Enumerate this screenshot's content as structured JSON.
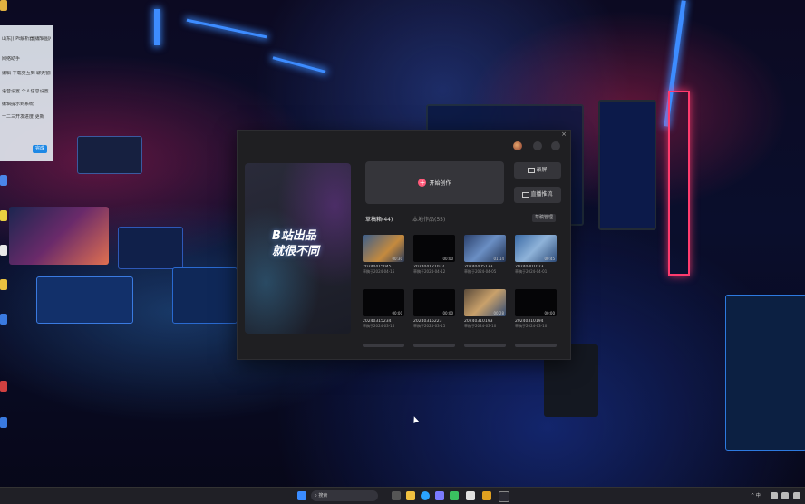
{
  "widget": {
    "rows": [
      "山东|( Pt解析器|编辑图片 第1步",
      "网络助手",
      "编辑 下载交互到 聊天窗口",
      "语音设置 个人信息设置",
      "编辑提示到系统",
      "一二三开发进度 更新"
    ],
    "button_label": "完成"
  },
  "app": {
    "close_label": "×",
    "banner_line1": "B站出品",
    "banner_line2": "就很不同",
    "start_label": "开始创作",
    "record_label": "录屏",
    "live_label": "直播推流",
    "tabs": [
      "草稿箱(44)",
      "本地作品(55)"
    ],
    "manage_label": "草稿管理",
    "drafts": [
      {
        "title": "20240415045",
        "meta": "草稿于2024-04-15",
        "duration": "00:30",
        "style": "s1"
      },
      {
        "title": "20240412102​2",
        "meta": "草稿于2024-04-12",
        "duration": "00:00",
        "style": "dark"
      },
      {
        "title": "20240405133",
        "meta": "草稿于2024-04-05",
        "duration": "01:14",
        "style": "s2"
      },
      {
        "title": "20240401023",
        "meta": "草稿于2024-04-01",
        "duration": "00:45",
        "style": "s3"
      },
      {
        "title": "20240315234",
        "meta": "草稿于2024-03-15",
        "duration": "00:00",
        "style": "dark"
      },
      {
        "title": "20240315223",
        "meta": "草稿于2024-03-15",
        "duration": "00:00",
        "style": "dark"
      },
      {
        "title": "20240310193",
        "meta": "草稿于2024-03-10",
        "duration": "00:28",
        "style": "s4"
      },
      {
        "title": "20240310194",
        "meta": "草稿于2024-03-10",
        "duration": "00:00",
        "style": "dark"
      }
    ]
  },
  "taskbar": {
    "search_placeholder": "搜索",
    "tray_text": "^ 中",
    "icons": [
      "windows-icon",
      "search-icon",
      "task-view-icon",
      "file-explorer-icon",
      "edge-icon",
      "store-icon",
      "wechat-icon",
      "app-icon-1",
      "app-icon-2",
      "app-icon-3"
    ]
  },
  "colors": {
    "accent": "#ff5a7a",
    "window": "#1f1f22",
    "taskbar": "#202026"
  }
}
